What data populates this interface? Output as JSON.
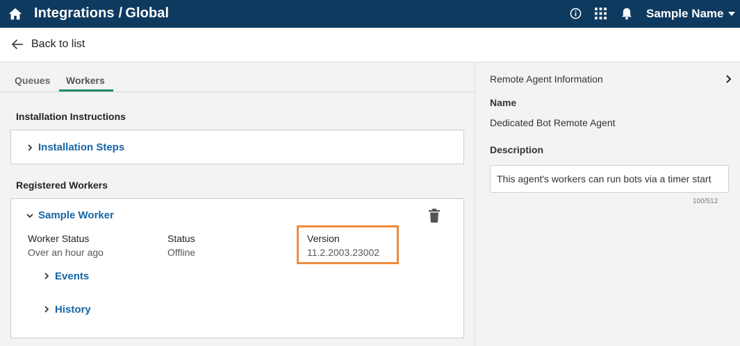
{
  "header": {
    "app_title": "Integrations",
    "separator": "/",
    "sub_title": "Global",
    "user_name": "Sample Name"
  },
  "nav": {
    "back_label": "Back to list"
  },
  "tabs": [
    {
      "label": "Queues",
      "active": false
    },
    {
      "label": "Workers",
      "active": true
    }
  ],
  "sections": {
    "installation_heading": "Installation Instructions",
    "installation_link": "Installation Steps",
    "registered_heading": "Registered Workers"
  },
  "worker": {
    "name": "Sample Worker",
    "fields": [
      {
        "label": "Worker Status",
        "value": "Over an hour ago"
      },
      {
        "label": "Status",
        "value": "Offline"
      },
      {
        "label": "Version",
        "value": "11.2.2003.23002"
      }
    ],
    "events_label": "Events",
    "history_label": "History"
  },
  "remote_agent": {
    "heading": "Remote Agent Information",
    "name_label": "Name",
    "name_value": "Dedicated Bot Remote Agent",
    "description_label": "Description",
    "description_value": "This agent's workers can run bots via a timer start",
    "char_count": "100/512"
  },
  "colors": {
    "header_bg": "#0f3a5f",
    "link": "#1565a6",
    "tab_accent": "#1b8a6b",
    "highlight": "#ef8a3b"
  },
  "icons": [
    "home-icon",
    "info-icon",
    "apps-grid-icon",
    "bell-icon",
    "arrow-left-icon",
    "chevron-right-icon",
    "chevron-down-icon",
    "trash-icon"
  ]
}
